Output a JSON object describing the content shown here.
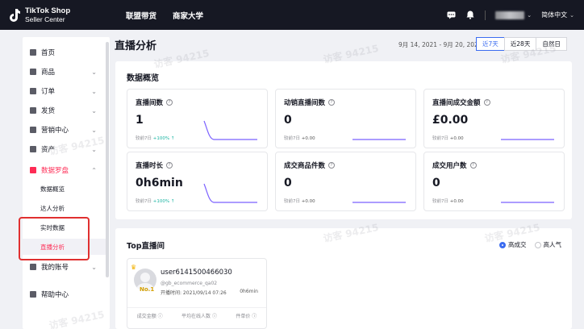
{
  "topbar": {
    "logo_line1": "TikTok Shop",
    "logo_line2": "Seller Center",
    "nav": [
      "联盟带货",
      "商家大学"
    ],
    "language": "简体中文"
  },
  "sidebar": {
    "items": [
      {
        "label": "首页",
        "icon": "home-icon",
        "expandable": false
      },
      {
        "label": "商品",
        "icon": "product-icon",
        "expandable": true
      },
      {
        "label": "订单",
        "icon": "order-icon",
        "expandable": true
      },
      {
        "label": "发货",
        "icon": "shipping-icon",
        "expandable": true
      },
      {
        "label": "营销中心",
        "icon": "marketing-icon",
        "expandable": true
      },
      {
        "label": "资产",
        "icon": "assets-icon",
        "expandable": true
      },
      {
        "label": "数据罗盘",
        "icon": "data-compass-icon",
        "expandable": true,
        "expanded": true
      },
      {
        "label": "我的账号",
        "icon": "account-icon",
        "expandable": true
      },
      {
        "label": "帮助中心",
        "icon": "help-icon",
        "expandable": false
      }
    ],
    "sub_items": [
      "数据概览",
      "达人分析",
      "实时数据",
      "直播分析"
    ],
    "selected_sub": "直播分析"
  },
  "header": {
    "title": "直播分析",
    "date_range": "9月 14, 2021 - 9月 20, 2021",
    "range_buttons": [
      "近7天",
      "近28天",
      "自然日"
    ],
    "active_range": "近7天"
  },
  "overview": {
    "title": "数据概览",
    "cards": [
      {
        "label": "直播间数",
        "value": "1",
        "compare_prefix": "较前7日",
        "compare": "+100%",
        "trend": "up"
      },
      {
        "label": "动销直播间数",
        "value": "0",
        "compare_prefix": "较前7日",
        "compare": "+0.00",
        "trend": "flat"
      },
      {
        "label": "直播间成交金额",
        "value": "£0.00",
        "compare_prefix": "较前7日",
        "compare": "+0.00",
        "trend": "flat"
      },
      {
        "label": "直播时长",
        "value": "0h6min",
        "compare_prefix": "较前7日",
        "compare": "+100%",
        "trend": "up"
      },
      {
        "label": "成交商品件数",
        "value": "0",
        "compare_prefix": "较前7日",
        "compare": "+0.00",
        "trend": "flat"
      },
      {
        "label": "成交用户数",
        "value": "0",
        "compare_prefix": "较前7日",
        "compare": "+0.00",
        "trend": "flat"
      }
    ]
  },
  "top_rooms": {
    "title": "Top直播间",
    "sort_options": [
      "高成交",
      "高人气"
    ],
    "sort_selected": "高成交",
    "streamer": {
      "name": "user6141500466030",
      "handle": "@gb_ecommerce_qa02",
      "start_time": "开播时间: 2021/09/14 07:26",
      "duration": "0h6min",
      "rank": "No.1",
      "metrics": [
        "成交金额",
        "平均在线人数",
        "件单价"
      ]
    }
  },
  "watermark": "访客 94215",
  "colors": {
    "accent": "#fe2c55",
    "link": "#3b6cf0",
    "trend": "#7b61ff",
    "topbar": "#161823"
  }
}
